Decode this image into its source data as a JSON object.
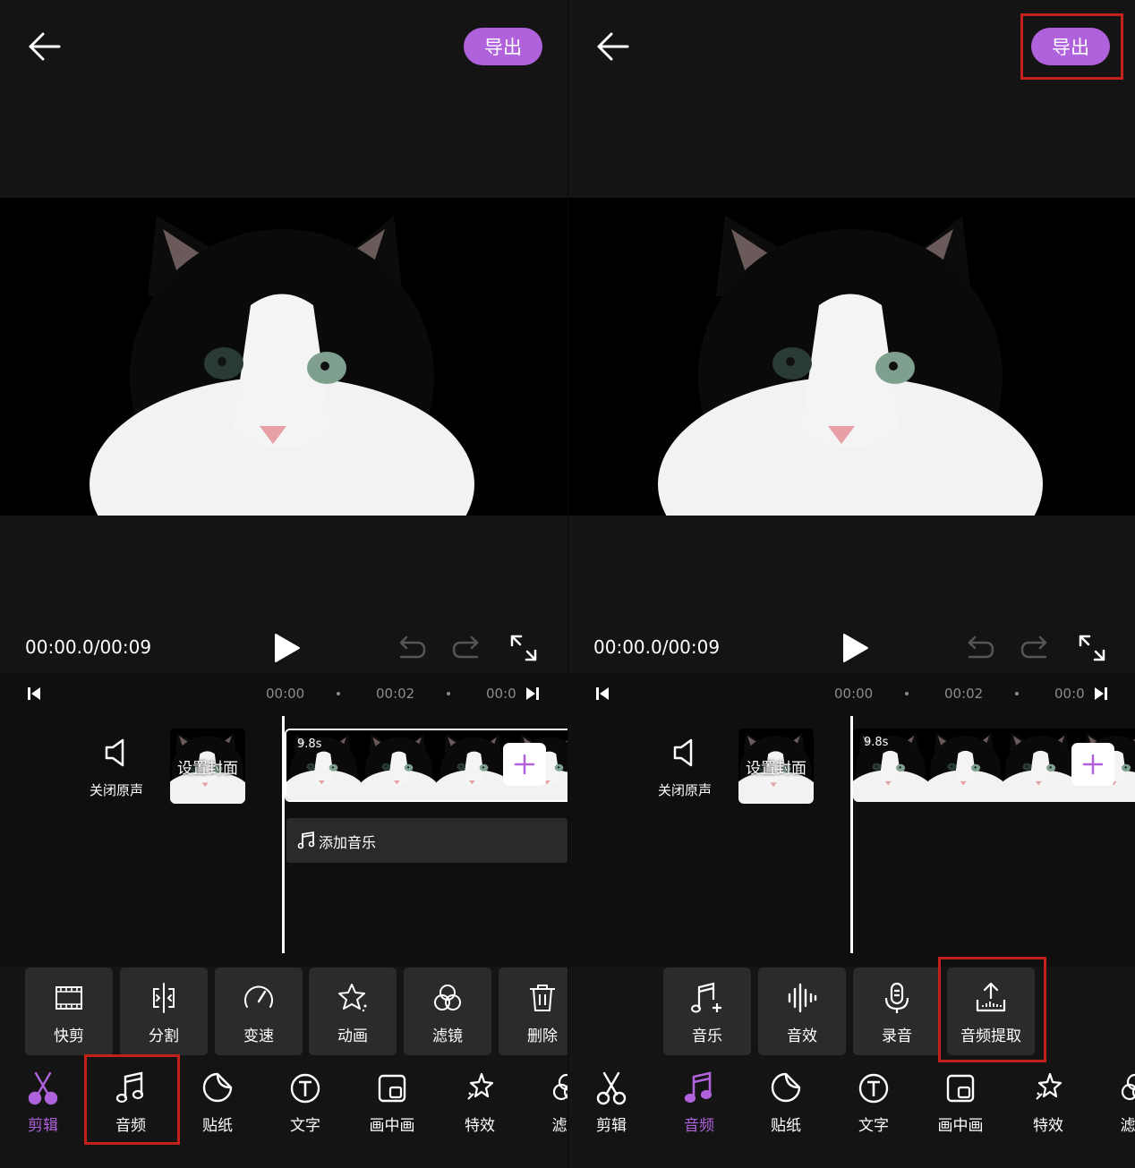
{
  "colors": {
    "accent": "#b062dd",
    "highlight": "#c4201c"
  },
  "left": {
    "export_label": "导出",
    "time": "00:00.0/00:09",
    "ruler": [
      "00:00",
      "00:02",
      "00:0"
    ],
    "mute_label": "关闭原声",
    "cover_label": "设置封面",
    "clip_duration": "9.8s",
    "add_music_label": "添加音乐",
    "tools": [
      {
        "label": "快剪",
        "icon": "quick-cut-icon"
      },
      {
        "label": "分割",
        "icon": "split-icon"
      },
      {
        "label": "变速",
        "icon": "speed-icon"
      },
      {
        "label": "动画",
        "icon": "animation-icon"
      },
      {
        "label": "滤镜",
        "icon": "filter-icon"
      },
      {
        "label": "删除",
        "icon": "delete-icon"
      }
    ],
    "nav": [
      {
        "label": "剪辑",
        "icon": "scissors-icon",
        "active": true
      },
      {
        "label": "音频",
        "icon": "music-note-icon",
        "active": false
      },
      {
        "label": "贴纸",
        "icon": "sticker-icon",
        "active": false
      },
      {
        "label": "文字",
        "icon": "text-icon",
        "active": false
      },
      {
        "label": "画中画",
        "icon": "picture-in-picture-icon",
        "active": false
      },
      {
        "label": "特效",
        "icon": "effects-icon",
        "active": false
      },
      {
        "label": "滤",
        "icon": "filter-icon",
        "active": false
      }
    ]
  },
  "right": {
    "export_label": "导出",
    "time": "00:00.0/00:09",
    "ruler": [
      "00:00",
      "00:02",
      "00:0"
    ],
    "mute_label": "关闭原声",
    "cover_label": "设置封面",
    "clip_duration": "9.8s",
    "tools": [
      {
        "label": "音乐",
        "icon": "add-music-icon"
      },
      {
        "label": "音效",
        "icon": "sound-effect-icon"
      },
      {
        "label": "录音",
        "icon": "microphone-icon"
      },
      {
        "label": "音频提取",
        "icon": "audio-extract-icon"
      }
    ],
    "nav": [
      {
        "label": "剪辑",
        "icon": "scissors-icon",
        "active": false
      },
      {
        "label": "音频",
        "icon": "music-note-icon",
        "active": true
      },
      {
        "label": "贴纸",
        "icon": "sticker-icon",
        "active": false
      },
      {
        "label": "文字",
        "icon": "text-icon",
        "active": false
      },
      {
        "label": "画中画",
        "icon": "picture-in-picture-icon",
        "active": false
      },
      {
        "label": "特效",
        "icon": "effects-icon",
        "active": false
      },
      {
        "label": "滤",
        "icon": "filter-icon",
        "active": false
      }
    ]
  }
}
